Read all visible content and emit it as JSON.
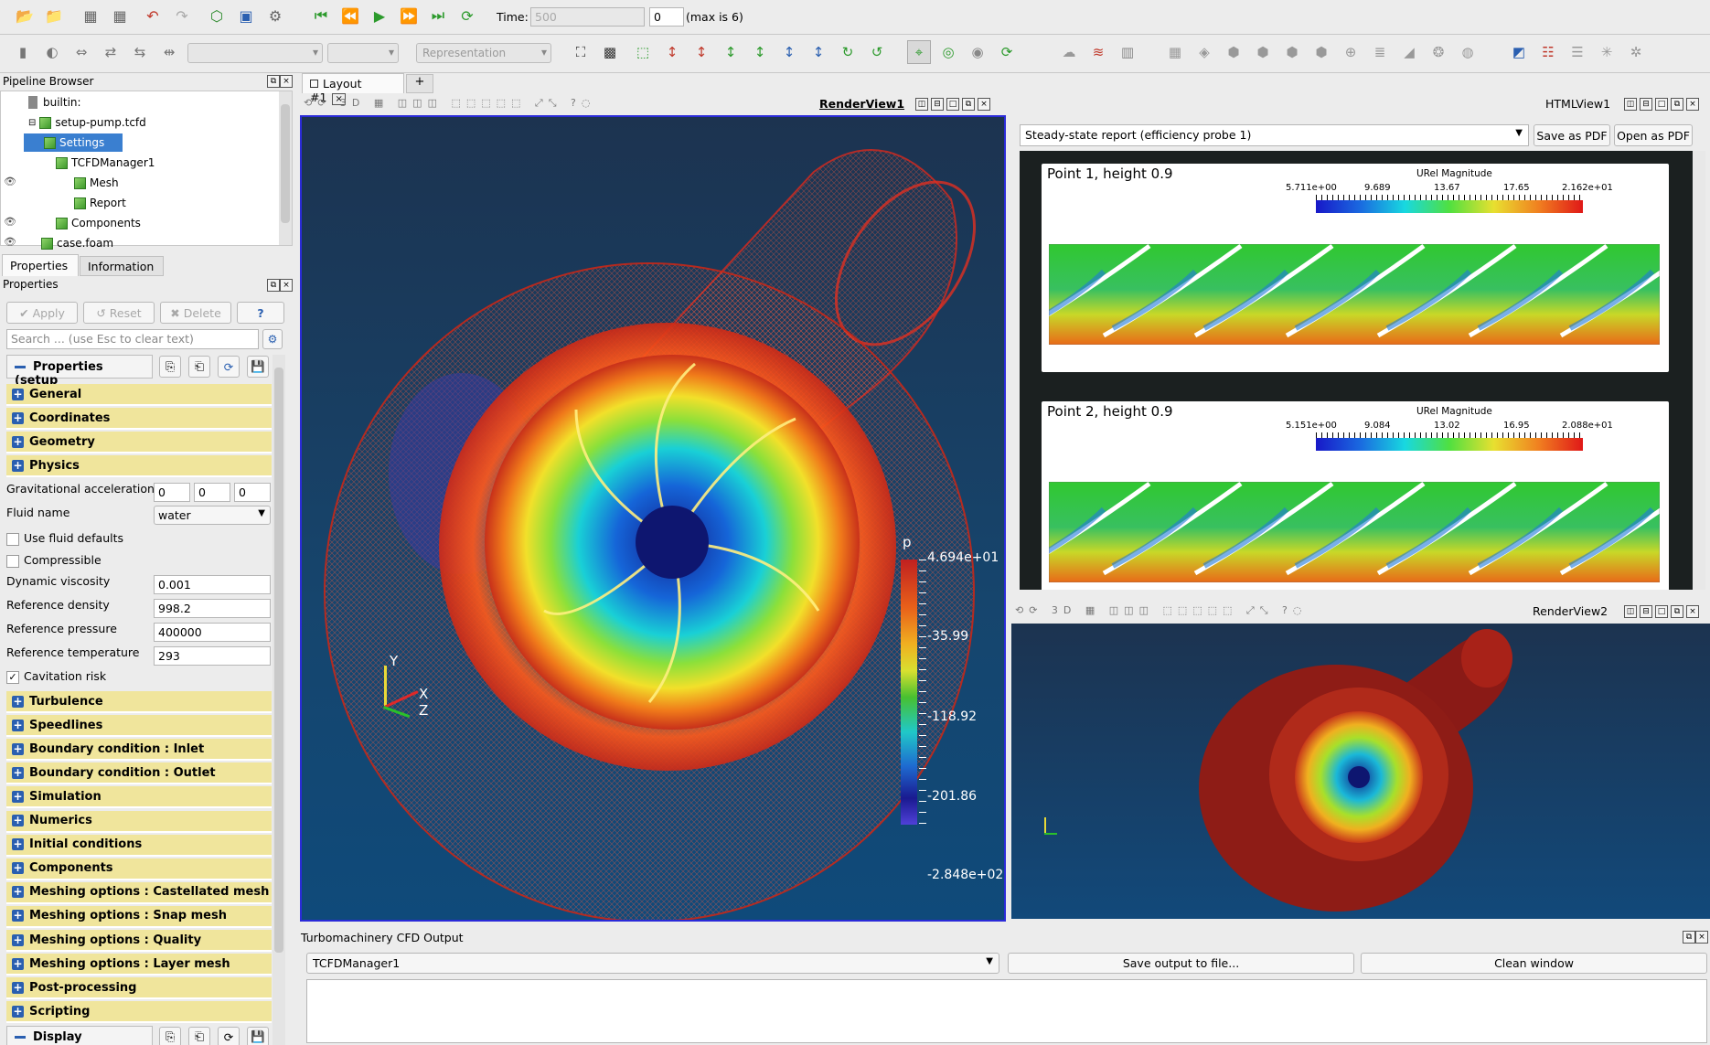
{
  "toolbar": {
    "time_label": "Time:",
    "time_value": "500",
    "step_value": "0",
    "max_label": "(max is 6)",
    "representation_placeholder": "Representation"
  },
  "pipeline": {
    "title": "Pipeline Browser",
    "items": [
      "builtin:",
      "setup-pump.tcfd",
      "Settings",
      "TCFDManager1",
      "Mesh",
      "Report",
      "Components",
      "case.foam"
    ]
  },
  "tabs": {
    "properties": "Properties",
    "information": "Information"
  },
  "properties": {
    "title": "Properties",
    "apply": "Apply",
    "reset": "Reset",
    "delete": "Delete",
    "help": "?",
    "search_placeholder": "Search ... (use Esc to clear text)",
    "section_header": "Properties (setup",
    "groups_top": [
      "General",
      "Coordinates",
      "Geometry",
      "Physics"
    ],
    "grav_label": "Gravitational acceleration",
    "grav": [
      "0",
      "0",
      "0"
    ],
    "fluid_label": "Fluid name",
    "fluid_value": "water",
    "use_fluid_defaults": "Use fluid defaults",
    "compressible": "Compressible",
    "dyn_visc_label": "Dynamic viscosity",
    "dyn_visc": "0.001",
    "ref_density_label": "Reference density",
    "ref_density": "998.2",
    "ref_pressure_label": "Reference pressure",
    "ref_pressure": "400000",
    "ref_temp_label": "Reference temperature",
    "ref_temp": "293",
    "cavitation": "Cavitation risk",
    "groups_bottom": [
      "Turbulence",
      "Speedlines",
      "Boundary condition : Inlet",
      "Boundary condition : Outlet",
      "Simulation",
      "Numerics",
      "Initial conditions",
      "Components",
      "Meshing options : Castellated mesh",
      "Meshing options : Snap mesh",
      "Meshing options : Quality",
      "Meshing options : Layer mesh",
      "Post-processing",
      "Scripting"
    ],
    "display": "Display"
  },
  "layout": {
    "tab": "Layout #1",
    "add": "+"
  },
  "render1": {
    "title": "RenderView1",
    "legend_title": "p",
    "legend_ticks": [
      "4.694e+01",
      "-35.99",
      "-118.92",
      "-201.86",
      "-2.848e+02"
    ],
    "axes": {
      "y": "Y",
      "x": "X",
      "z": "Z"
    }
  },
  "html_view": {
    "title": "HTMLView1",
    "select": "Steady-state report (efficiency probe 1)",
    "save_pdf": "Save as PDF",
    "open_pdf": "Open as PDF",
    "cards": [
      {
        "title": "Point 1, height 0.9",
        "bar_title": "URel Magnitude",
        "ticks": [
          "5.711e+00",
          "9.689",
          "13.67",
          "17.65",
          "2.162e+01"
        ]
      },
      {
        "title": "Point 2, height 0.9",
        "bar_title": "URel Magnitude",
        "ticks": [
          "5.151e+00",
          "9.084",
          "13.02",
          "16.95",
          "2.088e+01"
        ]
      }
    ]
  },
  "render2": {
    "title": "RenderView2"
  },
  "output": {
    "title": "Turbomachinery CFD Output",
    "select": "TCFDManager1",
    "save": "Save output to file...",
    "clean": "Clean window"
  },
  "colors": {
    "view_bg_top": "#1c3350",
    "view_bg_bottom": "#0f4a7a",
    "group_bg": "#f0e59c",
    "selection": "#3a7fd0"
  }
}
